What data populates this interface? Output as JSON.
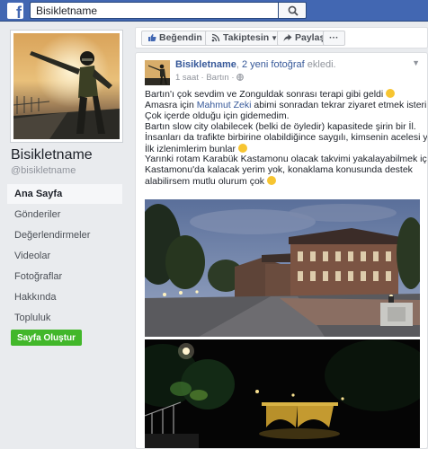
{
  "topbar": {
    "logo": "f",
    "search_value": "Bisikletname",
    "search_icon": "search-icon"
  },
  "sidebar": {
    "page_name": "Bisikletname",
    "handle": "@bisikletname",
    "nav": [
      {
        "label": "Ana Sayfa",
        "active": true
      },
      {
        "label": "Gönderiler"
      },
      {
        "label": "Değerlendirmeler"
      },
      {
        "label": "Videolar"
      },
      {
        "label": "Fotoğraflar"
      },
      {
        "label": "Hakkında"
      },
      {
        "label": "Topluluk"
      }
    ],
    "create_button": "Sayfa Oluştur"
  },
  "actions": {
    "like": "Beğendin",
    "follow": "Takiptesin",
    "share": "Paylaş",
    "more": "···"
  },
  "post": {
    "author": "Bisikletname",
    "comma": ",",
    "photos_link": "2 yeni fotoğraf",
    "added": "ekledi.",
    "time": "1 saat",
    "location": "Bartın",
    "lines": {
      "l1": "Bartın'ı çok sevdim ve Zonguldak sonrası terapi gibi geldi",
      "l2a": "Amasra için ",
      "l2_mention": "Mahmut Zeki",
      "l2b": " abimi sonradan tekrar ziyaret etmek isterim.",
      "l3": "Çok içerde olduğu için gidemedim.",
      "l4": "Bartın slow city olabilecek (belki de öyledir) kapasitede şirin bir İl.",
      "l5": "İnsanları da trafikte birbirine olabildiğince saygılı, kimsenin acelesi yok.",
      "l6": "İlk izlenimlerim bunlar",
      "l7": "Yarınki rotam Karabük Kastamonu olacak takvimi yakalayabilmek için.",
      "l8": "Kastamonu'da kalacak yerim yok, konaklama konusunda destek",
      "l9": "alabilirsem mutlu olurum çok"
    }
  },
  "colors": {
    "brand": "#4267b2",
    "link": "#365899",
    "create": "#42b72a"
  }
}
